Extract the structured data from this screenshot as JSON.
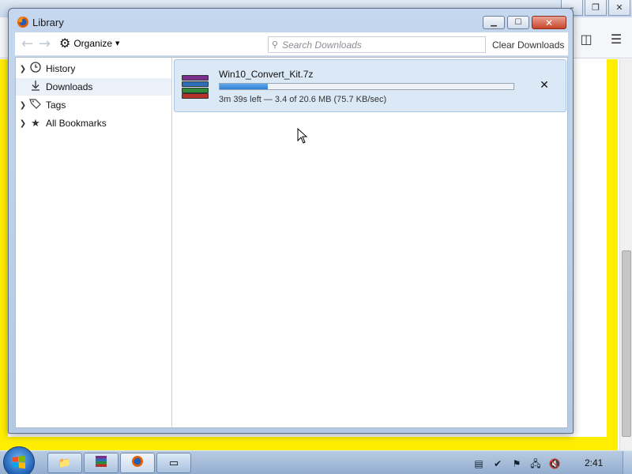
{
  "window": {
    "title": "Library"
  },
  "toolbar": {
    "organize_label": "Organize",
    "search_placeholder": "Search Downloads",
    "clear_downloads_label": "Clear Downloads"
  },
  "sidebar": {
    "items": [
      {
        "label": "History",
        "icon": "clock-icon",
        "expandable": true
      },
      {
        "label": "Downloads",
        "icon": "download-arrow-icon",
        "expandable": false,
        "selected": true
      },
      {
        "label": "Tags",
        "icon": "tag-icon",
        "expandable": true
      },
      {
        "label": "All Bookmarks",
        "icon": "star-icon",
        "expandable": true
      }
    ]
  },
  "downloads": [
    {
      "filename": "Win10_Convert_Kit.7z",
      "status": "3m 39s left — 3.4 of 20.6 MB (75.7 KB/sec)",
      "progress": 0.165,
      "icon": "winrar-archive-icon"
    }
  ],
  "taskbar": {
    "clock": "2:41",
    "apps": [
      "explorer-icon",
      "winrar-icon",
      "firefox-icon",
      "window-icon"
    ],
    "tray": [
      "document-icon",
      "security-check-icon",
      "action-center-flag-icon",
      "network-icon",
      "volume-muted-icon"
    ]
  },
  "colors": {
    "accent_yellow": "#ffee00",
    "selection_blue": "#dbe8f6",
    "progress_blue": "#2f80d6"
  }
}
